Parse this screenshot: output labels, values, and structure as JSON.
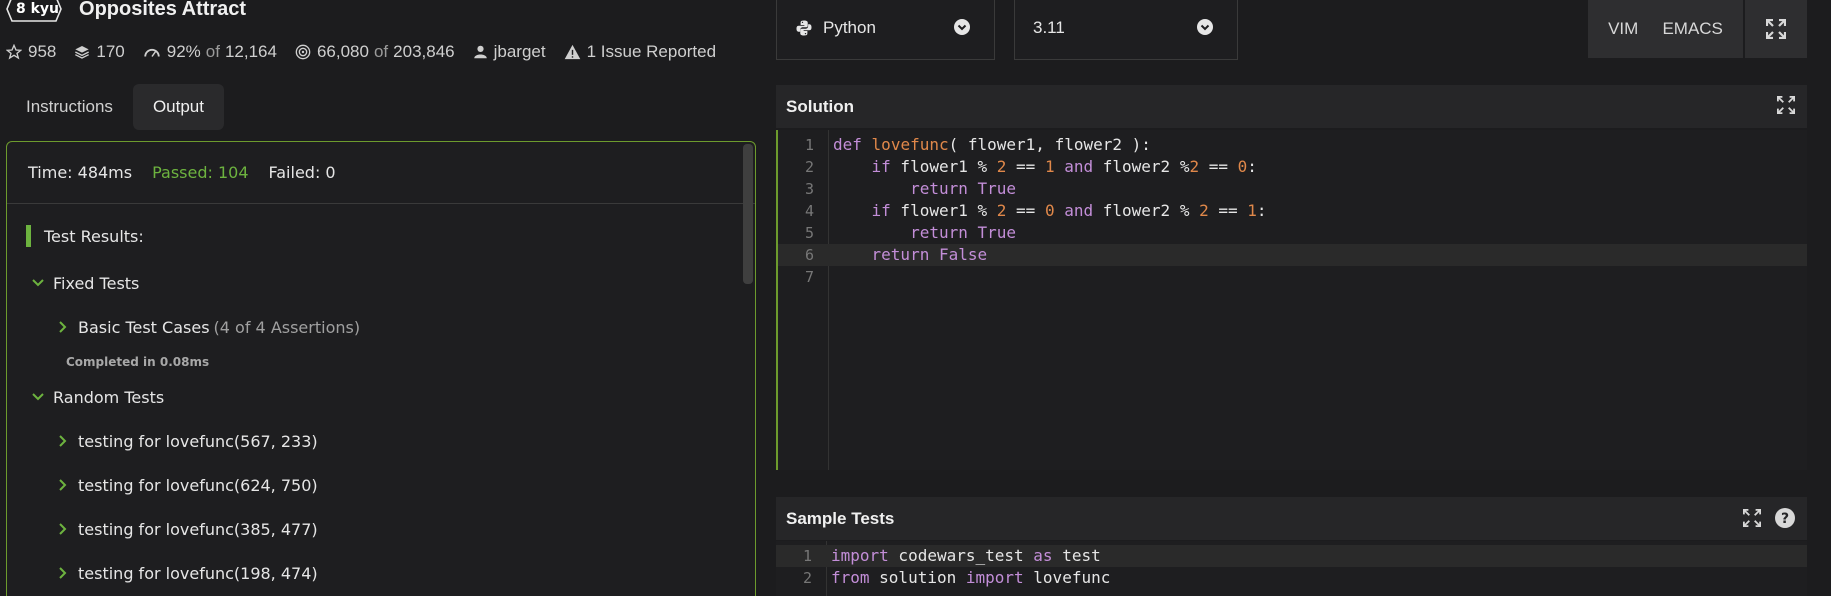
{
  "kata": {
    "rank": "8 kyu",
    "title": "Opposites Attract"
  },
  "stats": {
    "stars": "958",
    "collections": "170",
    "satisfaction": "92%",
    "satisfaction_of": "of",
    "satisfaction_total": "12,164",
    "completions": "66,080",
    "completions_of": "of",
    "completions_total": "203,846",
    "author": "jbarget",
    "issues": "1 Issue Reported"
  },
  "tabs": {
    "instructions": "Instructions",
    "output": "Output"
  },
  "output": {
    "time": "Time: 484ms",
    "passed": "Passed: 104",
    "failed": "Failed: 0",
    "results_title": "Test Results:",
    "fixed_group": "Fixed Tests",
    "basic_cases": "Basic Test Cases",
    "basic_assertions": "(4 of 4 Assertions)",
    "completed": "Completed in 0.08ms",
    "random_group": "Random Tests",
    "random_items": [
      "testing for lovefunc(567, 233)",
      "testing for lovefunc(624, 750)",
      "testing for lovefunc(385, 477)",
      "testing for lovefunc(198, 474)"
    ]
  },
  "toolbar": {
    "language": "Python",
    "version": "3.11",
    "vim": "VIM",
    "emacs": "EMACS"
  },
  "solution": {
    "title": "Solution",
    "line_numbers": [
      "1",
      "2",
      "3",
      "4",
      "5",
      "6",
      "7"
    ]
  },
  "sample_tests": {
    "title": "Sample Tests",
    "line_numbers": [
      "1",
      "2"
    ]
  },
  "colors": {
    "accent_green": "#6db33f",
    "border_green": "#6d9b2d",
    "keyword": "#c38ed8",
    "number": "#e0884a"
  },
  "icons": [
    "star-icon",
    "layers-icon",
    "gauge-icon",
    "target-icon",
    "user-icon",
    "warning-icon",
    "python-icon",
    "chevron-down-icon",
    "expand-icon",
    "help-icon"
  ]
}
